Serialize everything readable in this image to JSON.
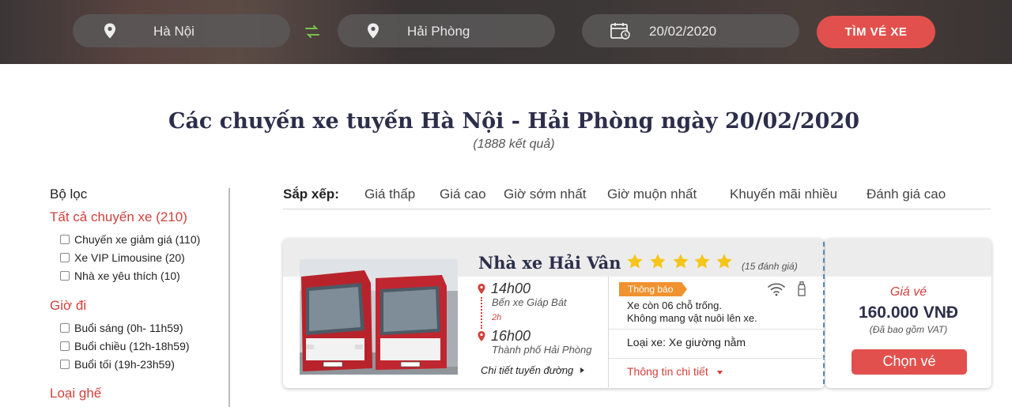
{
  "search": {
    "origin": "Hà Nội",
    "destination": "Hải Phòng",
    "date": "20/02/2020",
    "button": "TÌM VÉ XE"
  },
  "results": {
    "title": "Các chuyến xe tuyến Hà Nội - Hải Phòng ngày 20/02/2020",
    "count": "(1888 kết quả)"
  },
  "filter": {
    "heading": "Bộ lọc",
    "all_trips": "Tất cả chuyến xe (210)",
    "trip_options": [
      "Chuyến xe giảm giá (110)",
      "Xe VIP Limousine (20)",
      "Nhà xe yêu thích (10)"
    ],
    "time_heading": "Giờ đi",
    "time_options": [
      "Buổi sáng (0h- 11h59)",
      "Buổi chiều (12h-18h59)",
      "Buổi tối (19h-23h59)"
    ],
    "seat_heading": "Loại ghế"
  },
  "sort": {
    "label": "Sắp xếp:",
    "options": [
      "Giá thấp",
      "Giá cao",
      "Giờ sớm nhất",
      "Giờ muộn nhất",
      "Khuyến mãi nhiều",
      "Đánh giá cao"
    ]
  },
  "trip": {
    "operator": "Nhà xe Hải Vân",
    "rating_stars": 5,
    "reviews": "(15 đánh giá)",
    "depart_time": "14h00",
    "depart_station": "Bến xe Giáp Bát",
    "duration": "2h",
    "arrive_time": "16h00",
    "arrive_station": "Thành phố Hải Phòng",
    "route_link": "Chi tiết tuyến đường",
    "notice_tag": "Thông báo",
    "notice_lines": [
      "Xe còn 06 chỗ trống.",
      "Không mang vật nuôi lên xe."
    ],
    "bus_type": "Loại xe: Xe giường nằm",
    "detail_link": "Thông tin chi tiết",
    "price_label": "Giá vé",
    "price": "160.000 VNĐ",
    "vat_note": "(Đã bao gồm VAT)",
    "choose_button": "Chọn vé"
  },
  "colors": {
    "accent": "#e2504d",
    "title": "#2c2e4a",
    "star": "#f5c518",
    "notice": "#f0922f"
  },
  "icons": [
    "location-pin-icon",
    "swap-icon",
    "calendar-icon",
    "star-icon",
    "wifi-icon",
    "water-bottle-icon"
  ]
}
